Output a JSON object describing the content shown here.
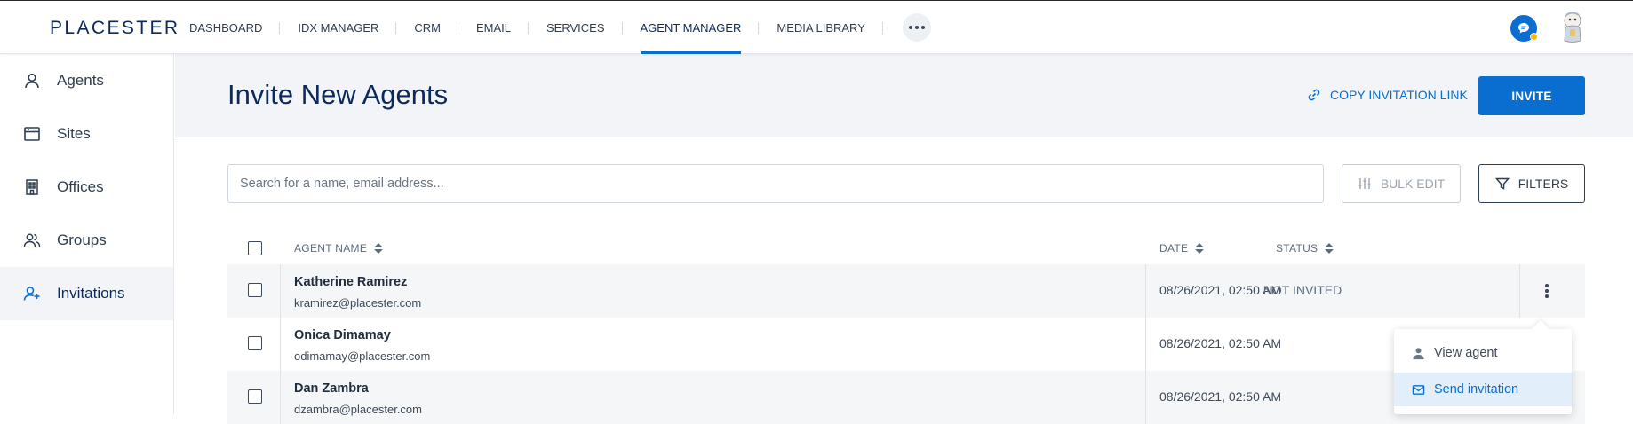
{
  "app": {
    "logo": "PLACESTER"
  },
  "nav": {
    "items": [
      {
        "label": "DASHBOARD"
      },
      {
        "label": "IDX MANAGER"
      },
      {
        "label": "CRM"
      },
      {
        "label": "EMAIL"
      },
      {
        "label": "SERVICES"
      },
      {
        "label": "AGENT MANAGER",
        "active": true
      },
      {
        "label": "MEDIA LIBRARY"
      }
    ],
    "more_icon": "ellipsis-icon",
    "chat_icon": "chat-icon",
    "avatar_icon": "user-avatar"
  },
  "sidebar": {
    "items": [
      {
        "label": "Agents",
        "icon": "user-icon"
      },
      {
        "label": "Sites",
        "icon": "browser-window-icon"
      },
      {
        "label": "Offices",
        "icon": "building-icon"
      },
      {
        "label": "Groups",
        "icon": "group-icon"
      },
      {
        "label": "Invitations",
        "icon": "user-plus-icon",
        "active": true
      }
    ]
  },
  "header": {
    "title": "Invite New Agents",
    "copy_link_label": "COPY INVITATION LINK",
    "invite_label": "INVITE"
  },
  "toolbar": {
    "search_placeholder": "Search for a name, email address...",
    "bulk_edit_label": "BULK EDIT",
    "filters_label": "FILTERS"
  },
  "table": {
    "columns": {
      "name": "AGENT NAME",
      "date": "DATE",
      "status": "STATUS"
    },
    "rows": [
      {
        "name": "Katherine Ramirez",
        "email": "kramirez@placester.com",
        "date": "08/26/2021, 02:50 AM",
        "status": "NOT INVITED"
      },
      {
        "name": "Onica Dimamay",
        "email": "odimamay@placester.com",
        "date": "08/26/2021, 02:50 AM",
        "status": ""
      },
      {
        "name": "Dan Zambra",
        "email": "dzambra@placester.com",
        "date": "08/26/2021, 02:50 AM",
        "status": ""
      }
    ]
  },
  "context_menu": {
    "items": [
      {
        "label": "View agent",
        "icon": "person-icon"
      },
      {
        "label": "Send invitation",
        "icon": "mail-icon",
        "highlighted": true
      }
    ]
  },
  "colors": {
    "accent": "#0a6ed1",
    "brand_text": "#0b2a5b",
    "header_band": "#f2f4f7",
    "chat_badge": "#f5b323"
  }
}
